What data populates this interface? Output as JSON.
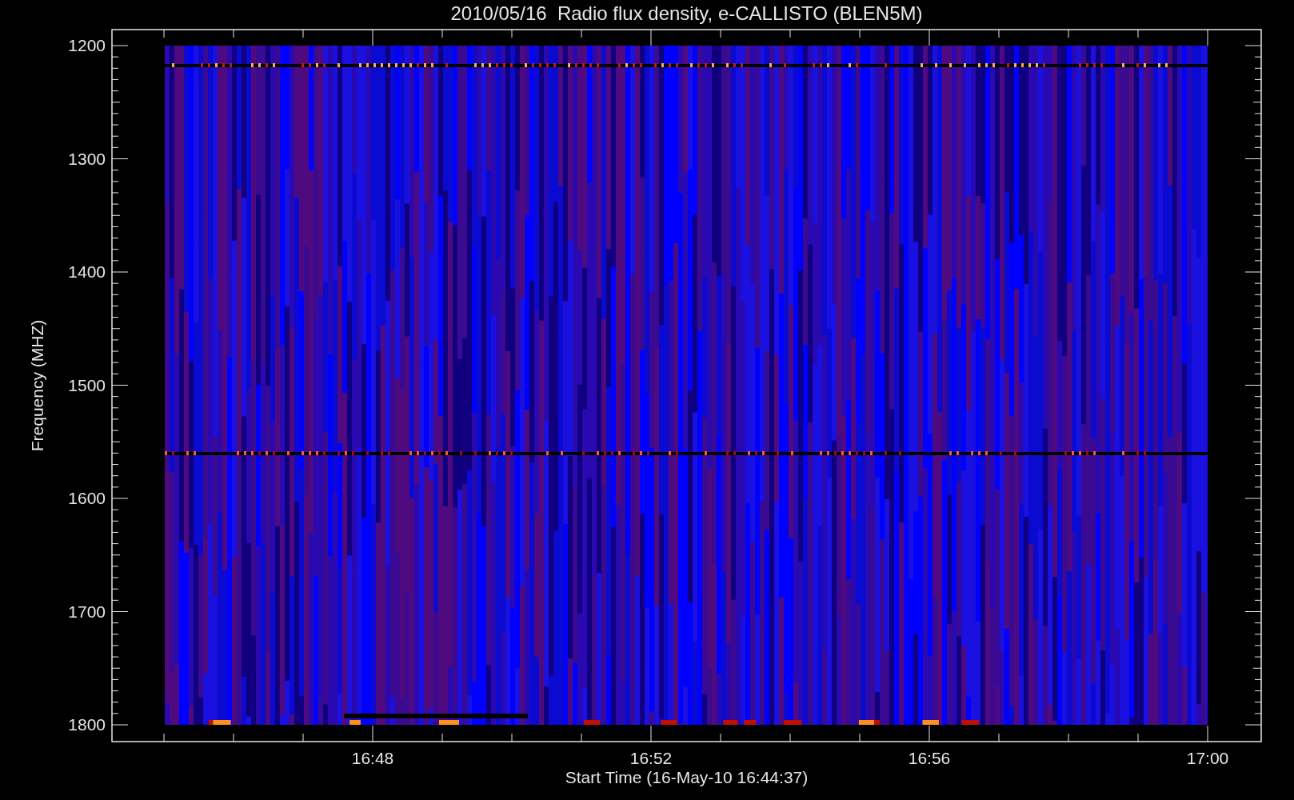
{
  "title": "2010/05/16  Radio flux density, e-CALLISTO (BLEN5M)",
  "y_axis": {
    "label": "Frequency (MHZ)",
    "ticks": [
      "1200",
      "1300",
      "1400",
      "1500",
      "1600",
      "1700",
      "1800"
    ]
  },
  "x_axis": {
    "label": "Start Time (16-May-10 16:44:37)",
    "ticks": [
      "16:48",
      "16:52",
      "16:56",
      "17:00"
    ]
  }
}
